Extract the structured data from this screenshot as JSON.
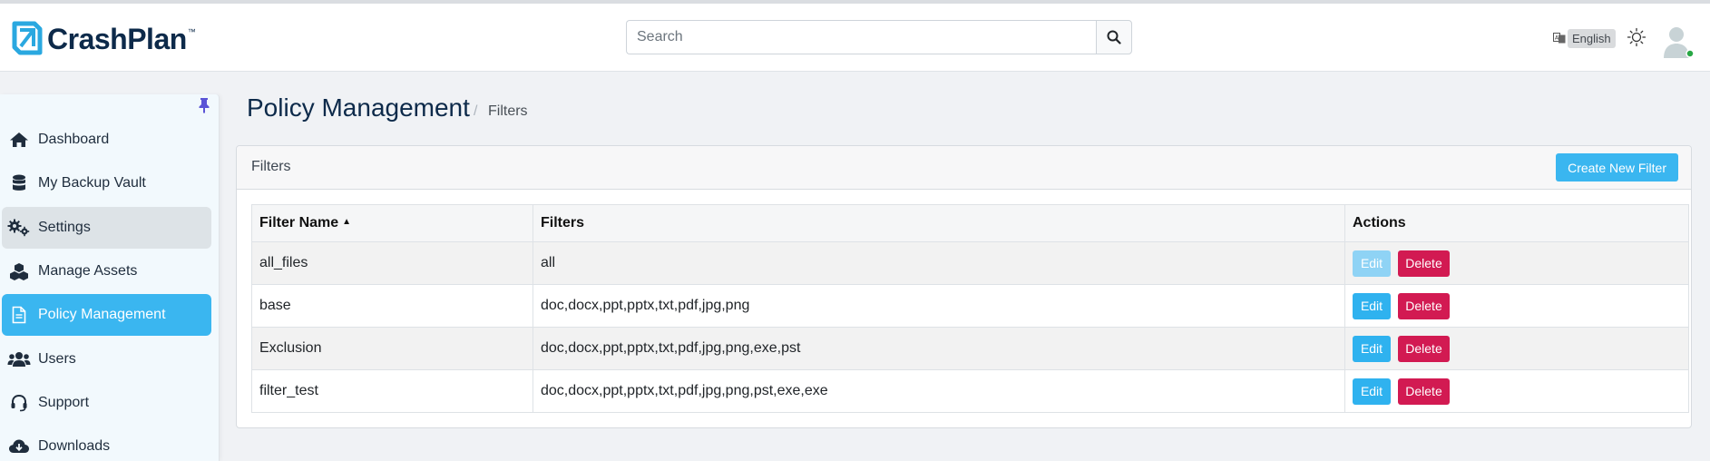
{
  "app": {
    "brand": "CrashPlan",
    "trademark": "™"
  },
  "header": {
    "search": {
      "placeholder": "Search",
      "value": ""
    },
    "language": "English"
  },
  "sidebar": {
    "items": [
      {
        "label": "Dashboard",
        "icon": "home-icon",
        "state": "normal"
      },
      {
        "label": "My Backup Vault",
        "icon": "database-icon",
        "state": "normal"
      },
      {
        "label": "Settings",
        "icon": "gears-icon",
        "state": "hover"
      },
      {
        "label": "Manage Assets",
        "icon": "cubes-icon",
        "state": "normal"
      },
      {
        "label": "Policy Management",
        "icon": "file-icon",
        "state": "active"
      },
      {
        "label": "Users",
        "icon": "users-icon",
        "state": "normal"
      },
      {
        "label": "Support",
        "icon": "headset-icon",
        "state": "normal"
      },
      {
        "label": "Downloads",
        "icon": "cloud-download-icon",
        "state": "normal"
      }
    ]
  },
  "page": {
    "title": "Policy Management",
    "breadcrumb_sep": "/",
    "breadcrumb": "Filters"
  },
  "card": {
    "title": "Filters",
    "create_label": "Create New Filter"
  },
  "table": {
    "headers": {
      "name": "Filter Name",
      "filters": "Filters",
      "actions": "Actions"
    },
    "rows": [
      {
        "name": "all_files",
        "filters": "all",
        "edit": "Edit",
        "delete": "Delete",
        "edit_disabled": true
      },
      {
        "name": "base",
        "filters": "doc,docx,ppt,pptx,txt,pdf,jpg,png",
        "edit": "Edit",
        "delete": "Delete",
        "edit_disabled": false
      },
      {
        "name": "Exclusion",
        "filters": "doc,docx,ppt,pptx,txt,pdf,jpg,png,exe,pst",
        "edit": "Edit",
        "delete": "Delete",
        "edit_disabled": false
      },
      {
        "name": "filter_test",
        "filters": "doc,docx,ppt,pptx,txt,pdf,jpg,png,pst,exe,exe",
        "edit": "Edit",
        "delete": "Delete",
        "edit_disabled": false
      }
    ]
  },
  "colors": {
    "accent": "#3ab6f0",
    "danger": "#d21a52",
    "brand_dark": "#0d2a4a",
    "online": "#28a745"
  }
}
